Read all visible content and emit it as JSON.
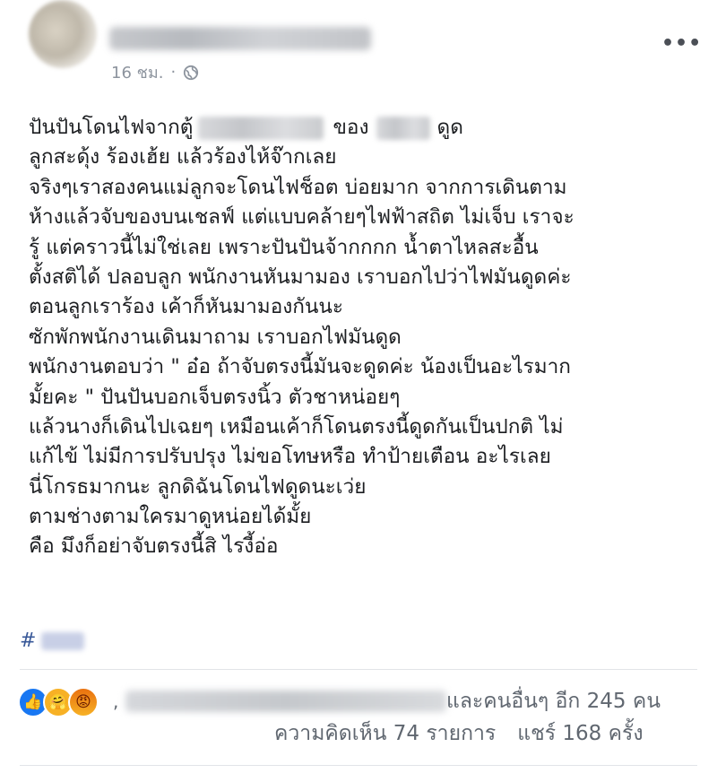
{
  "post": {
    "timestamp": "16 ชม.",
    "separator": "·",
    "privacy_icon": "globe-icon",
    "more_icon": "more-options-icon",
    "lines": [
      "ปันปันโดนไฟจากตู้",
      "ของ",
      "ดูด",
      "ลูกสะดุ้ง ร้องเฮ้ย แล้วร้องไห้จ๊ากเลย",
      "จริงๆเราสองคนแม่ลูกจะโดนไฟช็อต บ่อยมาก จากการเดินตาม",
      "ห้างแล้วจับของบนเชลฟ์ แต่แบบคล้ายๆไฟฟ้าสถิต ไม่เจ็บ เราจะ",
      "รู้ แต่คราวนี้ไม่ใช่เลย เพราะปันปันจ้ากกกก น้ำตาไหลสะอื้น",
      "ตั้งสติได้ ปลอบลูก พนักงานหันมามอง เราบอกไปว่าไฟมันดูดค่ะ",
      "ตอนลูกเราร้อง เค้าก็หันมามองกันนะ",
      "ซักพักพนักงานเดินมาถาม เราบอกไฟมันดูด",
      "พนักงานตอบว่า \" อ๋อ ถ้าจับตรงนี้มันจะดูดค่ะ น้องเป็นอะไรมาก",
      "มั้ยคะ \" ปันปันบอกเจ็บตรงนิ้ว ตัวชาหน่อยๆ",
      "แล้วนางก็เดินไปเฉยๆ เหมือนเค้าก็โดนตรงนี้ดูดกันเป็นปกติ ไม่",
      "แก้ไข้ ไม่มีการปรับปรุง ไม่ขอโทษหรือ ทำป้ายเตือน อะไรเลย",
      "นี่โกรธมากนะ ลูกดิฉันโดนไฟดูดนะเว่ย",
      "ตามช่างตามใครมาดูหน่อยได้มั้ย",
      "คือ มึงก็อย่าจับตรงนี้สิ ไรงี้อ่อ"
    ],
    "hashtag_symbol": "#"
  },
  "reactions": {
    "icons": [
      "like-icon",
      "care-icon",
      "angry-icon"
    ],
    "like_glyph": "👍",
    "care_glyph": "🤗",
    "angry_glyph": "😡",
    "comma": ",",
    "others_text": "และคนอื่นๆ อีก 245 คน",
    "comments_text": "ความคิดเห็น 74 รายการ",
    "shares_text": "แชร์ 168 ครั้ง"
  },
  "colors": {
    "link": "#385898",
    "like_blue": "#1877f2",
    "meta_gray": "#606770"
  }
}
